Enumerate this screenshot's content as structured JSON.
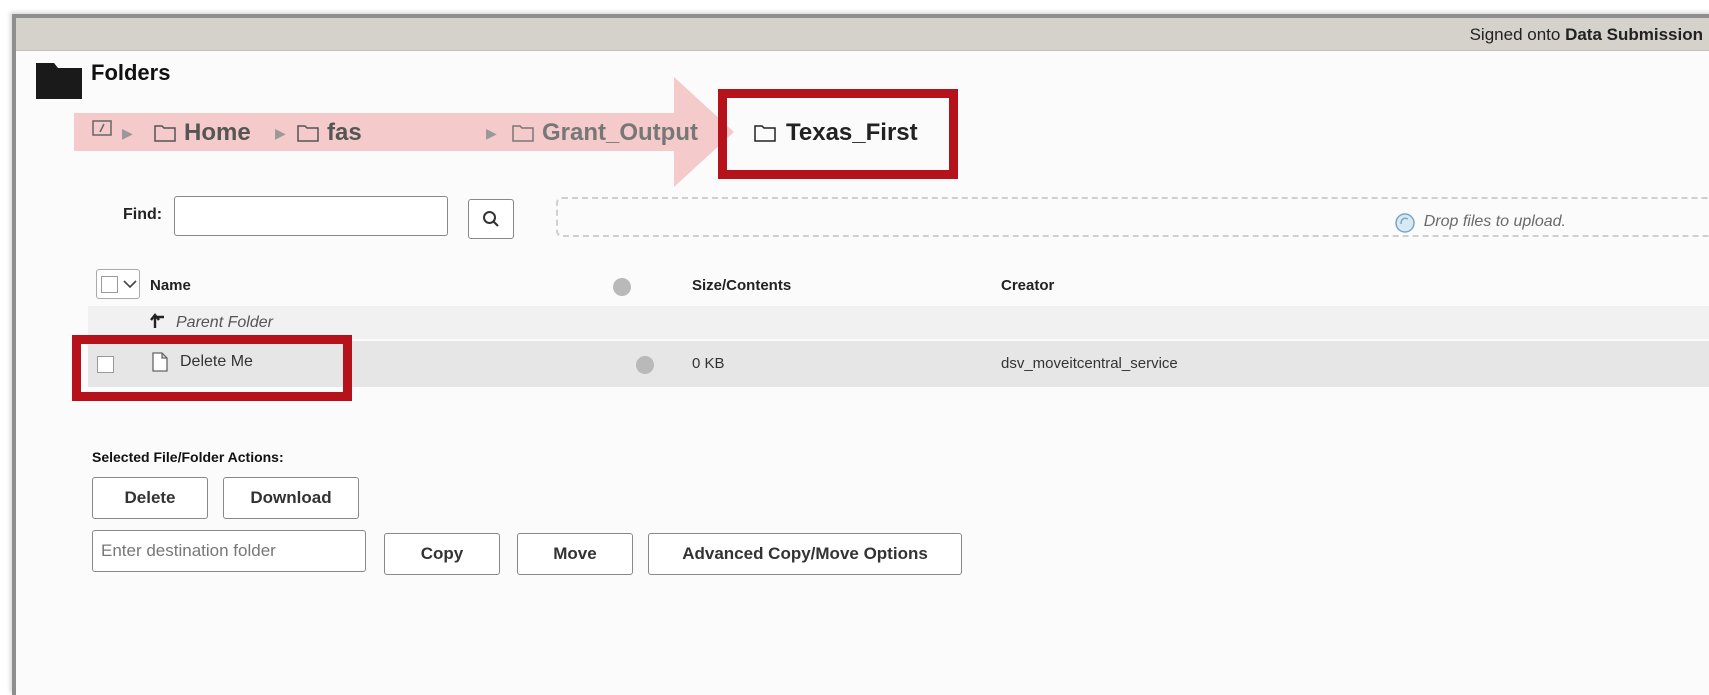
{
  "header": {
    "signed_prefix": "Signed onto",
    "signed_org": "Data Submission"
  },
  "page": {
    "title": "Folders"
  },
  "breadcrumb": {
    "home": "Home",
    "fas": "fas",
    "grant": "Grant_Output",
    "current": "Texas_First"
  },
  "find": {
    "label": "Find:",
    "value": ""
  },
  "dropzone": {
    "text": "Drop files to upload."
  },
  "table": {
    "col_name": "Name",
    "col_size": "Size/Contents",
    "col_creator": "Creator",
    "parent_label": "Parent Folder",
    "file": {
      "name": "Delete Me",
      "size": "0 KB",
      "creator": "dsv_moveitcentral_service"
    }
  },
  "actions": {
    "label": "Selected File/Folder Actions:",
    "delete": "Delete",
    "download": "Download",
    "dest_placeholder": "Enter destination folder",
    "copy": "Copy",
    "move": "Move",
    "advanced": "Advanced Copy/Move Options"
  },
  "colors": {
    "highlight": "#b5121b",
    "arrow": "#f3c1c1"
  }
}
